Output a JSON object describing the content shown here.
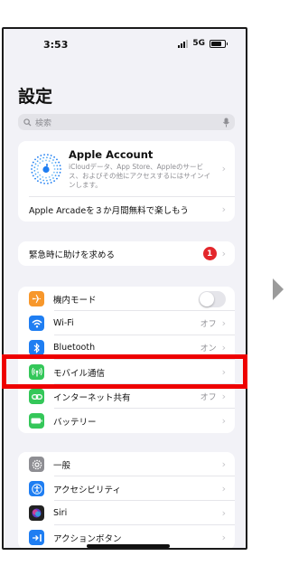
{
  "status": {
    "time": "3:53",
    "network": "5G"
  },
  "header": {
    "title": "設定"
  },
  "search": {
    "placeholder": "検索"
  },
  "account": {
    "title": "Apple Account",
    "description": "iCloudデータ、App Store、Appleのサービス、およびその他にアクセスするにはサインインします。",
    "promo": "Apple Arcadeを３か月間無料で楽しもう"
  },
  "emergency": {
    "label": "緊急時に助けを求める",
    "badge": "1"
  },
  "connectivity": [
    {
      "label": "機内モード",
      "value": "",
      "icon": "airplane-icon",
      "color": "#f7972b"
    },
    {
      "label": "Wi-Fi",
      "value": "オフ",
      "icon": "wifi-icon",
      "color": "#1f7ef2"
    },
    {
      "label": "Bluetooth",
      "value": "オン",
      "icon": "bluetooth-icon",
      "color": "#1f7ef2"
    },
    {
      "label": "モバイル通信",
      "value": "",
      "icon": "antenna-icon",
      "color": "#34c759"
    },
    {
      "label": "インターネット共有",
      "value": "オフ",
      "icon": "link-icon",
      "color": "#34c759"
    },
    {
      "label": "バッテリー",
      "value": "",
      "icon": "battery-icon",
      "color": "#34c759"
    }
  ],
  "general": [
    {
      "label": "一般",
      "icon": "gear-icon",
      "color": "#8e8e93"
    },
    {
      "label": "アクセシビリティ",
      "icon": "accessibility-icon",
      "color": "#1f7ef2"
    },
    {
      "label": "Siri",
      "icon": "siri-icon",
      "color": "#222222"
    },
    {
      "label": "アクションボタン",
      "icon": "action-button-icon",
      "color": "#1f7ef2"
    }
  ],
  "colors": {
    "highlight": "#ee0000",
    "background": "#f2f2f7"
  }
}
